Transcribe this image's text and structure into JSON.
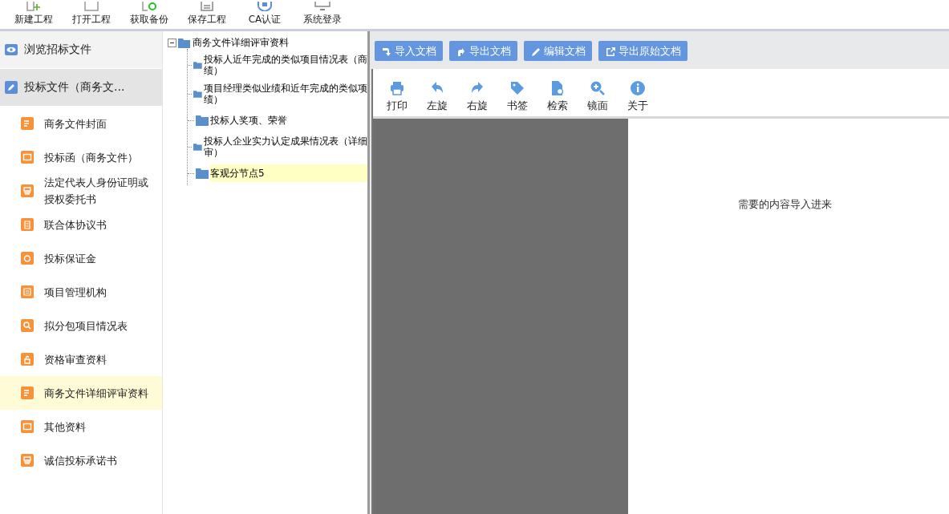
{
  "toolbar": [
    {
      "label": "新建工程",
      "kind": "new"
    },
    {
      "label": "打开工程",
      "kind": "open"
    },
    {
      "label": "获取备份",
      "kind": "backup"
    },
    {
      "label": "保存工程",
      "kind": "save"
    },
    {
      "label": "CA认证",
      "kind": "lock"
    },
    {
      "label": "系统登录",
      "kind": "login"
    }
  ],
  "sidebar": {
    "sections": [
      {
        "label": "浏览招标文件",
        "kind": "eye",
        "selected": false
      },
      {
        "label": "投标文件（商务文...",
        "kind": "edit",
        "selected": true
      }
    ],
    "items": [
      {
        "label": "商务文件封面",
        "kind": "doc",
        "selected": false
      },
      {
        "label": "投标函（商务文件）",
        "kind": "ticket",
        "selected": false
      },
      {
        "label": "法定代表人身份证明或授权委托书",
        "kind": "printer",
        "selected": false
      },
      {
        "label": "联合体协议书",
        "kind": "clipboard",
        "selected": false
      },
      {
        "label": "投标保证金",
        "kind": "coin",
        "selected": false
      },
      {
        "label": "项目管理机构",
        "kind": "note",
        "selected": false
      },
      {
        "label": "拟分包项目情况表",
        "kind": "search",
        "selected": false
      },
      {
        "label": "资格审查资料",
        "kind": "lock",
        "selected": false
      },
      {
        "label": "商务文件详细评审资料",
        "kind": "doc",
        "selected": true
      },
      {
        "label": "其他资料",
        "kind": "ticket",
        "selected": false
      },
      {
        "label": "诚信投标承诺书",
        "kind": "printer",
        "selected": false
      }
    ]
  },
  "tree": {
    "label": "商务文件详细评审资料",
    "expanded": true,
    "children": [
      {
        "lines": [
          "投标人近年完成的类似项目情况表（商",
          "绩）"
        ],
        "selected": false
      },
      {
        "lines": [
          "项目经理类似业绩和近年完成的类似项",
          "绩）"
        ],
        "selected": false
      },
      {
        "lines": [
          "投标人奖项、荣誉"
        ],
        "selected": false
      },
      {
        "lines": [
          "投标人企业实力认定成果情况表（详细",
          "审）"
        ],
        "selected": false
      },
      {
        "lines": [
          "客观分节点5"
        ],
        "selected": true
      }
    ]
  },
  "doc_buttons": [
    {
      "label": "导入文档",
      "kind": "import"
    },
    {
      "label": "导出文档",
      "kind": "export"
    },
    {
      "label": "编辑文档",
      "kind": "edit"
    },
    {
      "label": "导出原始文档",
      "kind": "external"
    }
  ],
  "viewer_tools": [
    {
      "label": "打印",
      "kind": "print"
    },
    {
      "label": "左旋",
      "kind": "left"
    },
    {
      "label": "右旋",
      "kind": "right"
    },
    {
      "label": "书签",
      "kind": "tag"
    },
    {
      "label": "检索",
      "kind": "find"
    },
    {
      "label": "镜面",
      "kind": "zoom"
    },
    {
      "label": "关于",
      "kind": "info"
    }
  ],
  "page_text": "需要的内容导入进来"
}
